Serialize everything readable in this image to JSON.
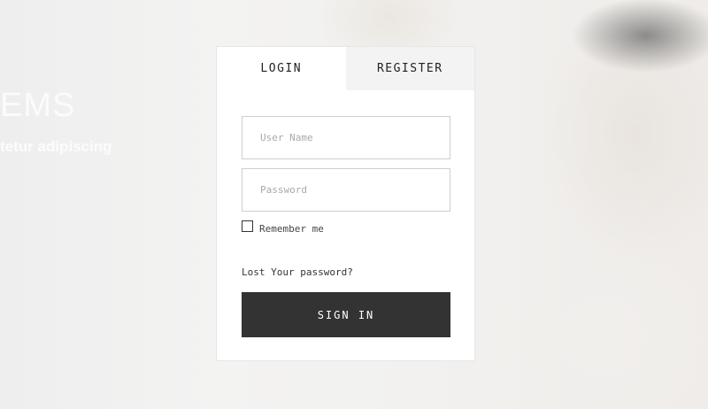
{
  "background": {
    "hero_heading_partial": "EMS",
    "hero_sub_partial": "tetur adipiscing"
  },
  "tabs": [
    {
      "label": "LOGIN",
      "active": true
    },
    {
      "label": "REGISTER",
      "active": false
    }
  ],
  "form": {
    "username_placeholder": "User Name",
    "username_value": "",
    "password_placeholder": "Password",
    "password_value": "",
    "remember_label": "Remember me",
    "remember_checked": false,
    "lost_password_label": "Lost Your password?",
    "submit_label": "SIGN IN"
  },
  "colors": {
    "button_bg": "#333333",
    "inactive_tab_bg": "#f3f3f3",
    "card_bg": "#ffffff"
  }
}
